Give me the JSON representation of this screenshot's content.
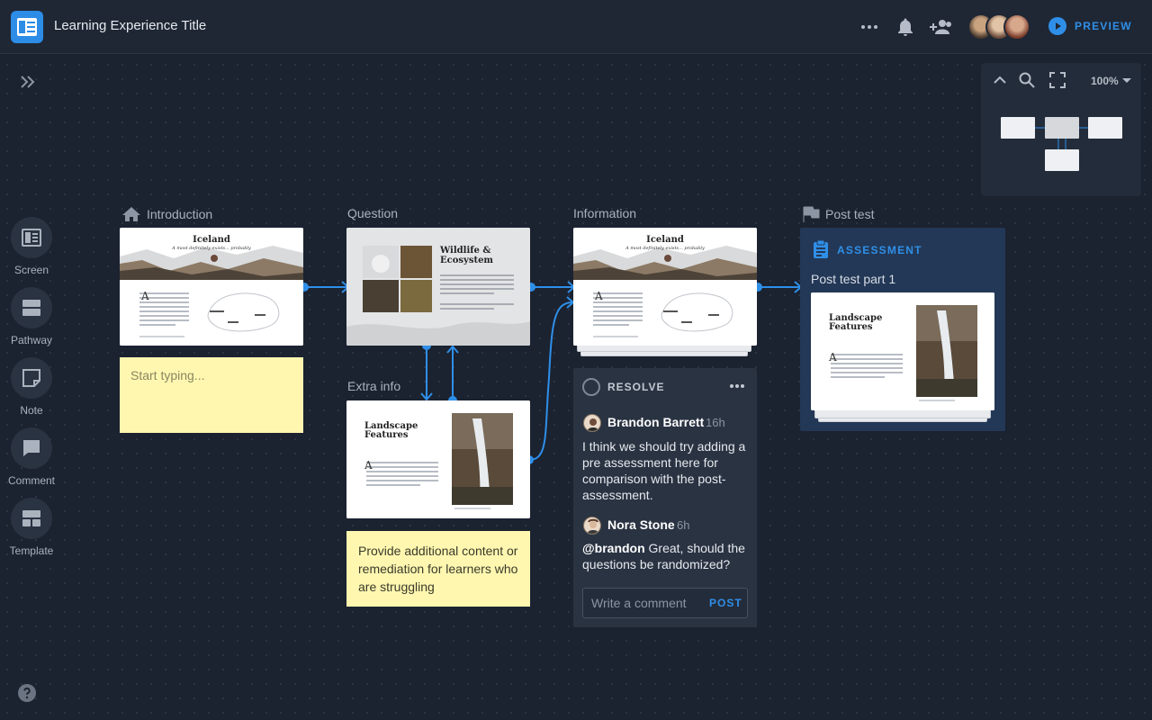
{
  "app": {
    "title": "Learning Experience Title"
  },
  "header": {
    "preview_label": "PREVIEW"
  },
  "tools": [
    {
      "label": "Screen"
    },
    {
      "label": "Pathway"
    },
    {
      "label": "Note"
    },
    {
      "label": "Comment"
    },
    {
      "label": "Template"
    }
  ],
  "minimap": {
    "zoom": "100%"
  },
  "columns": {
    "introduction": "Introduction",
    "question": "Question",
    "information": "Information",
    "post_test": "Post test",
    "extra_info": "Extra info"
  },
  "cards": {
    "iceland_title": "Iceland",
    "iceland_subtitle": "A most definitely exists... probably",
    "wildlife_title": "Wildlife & Ecosystem",
    "landscape_title": "Landscape Features"
  },
  "notes": {
    "intro_placeholder": "Start typing...",
    "extra_note": "Provide additional content or remediation for learners who are struggling"
  },
  "comments": {
    "resolve_label": "RESOLVE",
    "items": [
      {
        "author": "Brandon Barrett",
        "time": "16h",
        "text": "I think we should try adding a pre assessment here for comparison with the post-assessment."
      },
      {
        "author": "Nora Stone",
        "time": "6h",
        "mention": "@brandon",
        "text": " Great, should  the questions be randomized?"
      }
    ],
    "input_placeholder": "Write a comment",
    "post_label": "POST"
  },
  "assessment": {
    "header": "ASSESSMENT",
    "title": "Post test part 1"
  },
  "colors": {
    "accent": "#2f8fe8",
    "background": "#1b2230",
    "note": "#fff7b0",
    "assessment_bg": "#233856"
  }
}
